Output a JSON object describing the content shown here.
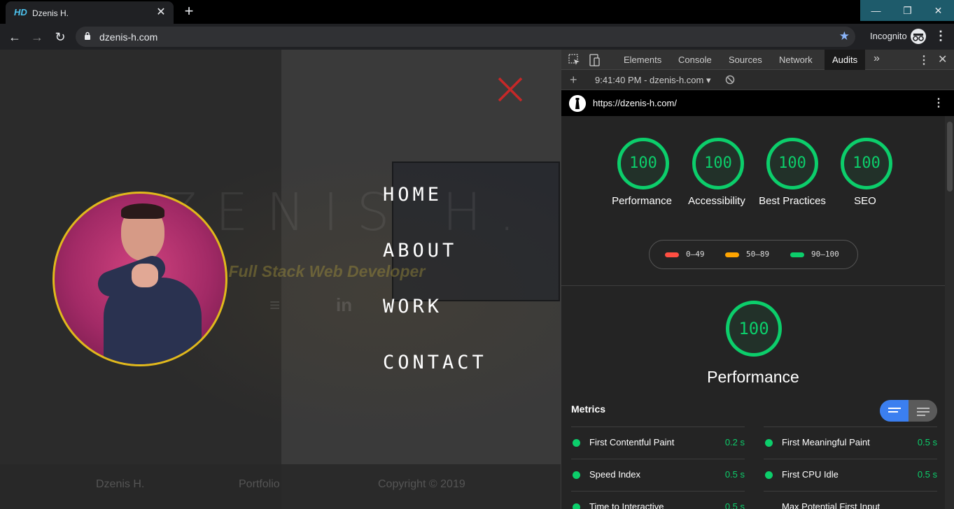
{
  "browser": {
    "tab_title": "Dzenis H.",
    "tab_favicon": "HD",
    "url": "dzenis-h.com",
    "incognito_label": "Incognito"
  },
  "page": {
    "ghost_title": "DZENIS H.",
    "ghost_subtitle": "Competent Full Stack Web Developer",
    "nav": [
      "HOME",
      "ABOUT",
      "WORK",
      "CONTACT"
    ],
    "footer": [
      "Dzenis H.",
      "Portfolio",
      "Copyright © 2019"
    ],
    "colors": {
      "close_x": "#c62828",
      "avatar_ring": "#e0b91c"
    }
  },
  "devtools": {
    "tabs": [
      "Elements",
      "Console",
      "Sources",
      "Network",
      "Audits"
    ],
    "active_tab": "Audits",
    "report_label": "9:41:40 PM - dzenis-h.com",
    "audit_url": "https://dzenis-h.com/",
    "scores": [
      {
        "score": "100",
        "label": "Performance"
      },
      {
        "score": "100",
        "label": "Accessibility"
      },
      {
        "score": "100",
        "label": "Best Practices"
      },
      {
        "score": "100",
        "label": "SEO"
      }
    ],
    "legend": [
      {
        "range": "0–49",
        "color": "#ff4e42"
      },
      {
        "range": "50–89",
        "color": "#ffa400"
      },
      {
        "range": "90–100",
        "color": "#0cce6b"
      }
    ],
    "category_score": "100",
    "category_title": "Performance",
    "metrics_title": "Metrics",
    "metrics": [
      {
        "name": "First Contentful Paint",
        "value": "0.2 s"
      },
      {
        "name": "First Meaningful Paint",
        "value": "0.5 s"
      },
      {
        "name": "Speed Index",
        "value": "0.5 s"
      },
      {
        "name": "First CPU Idle",
        "value": "0.5 s"
      },
      {
        "name": "Time to Interactive",
        "value": "0.5 s"
      },
      {
        "name": "Max Potential First Input",
        "value": ""
      }
    ]
  }
}
